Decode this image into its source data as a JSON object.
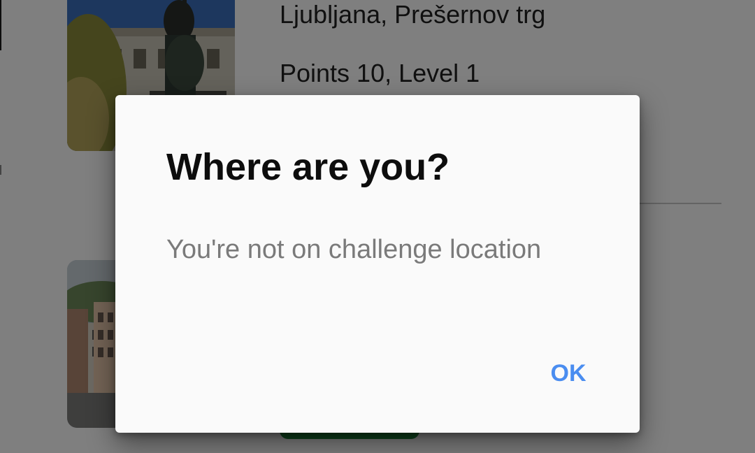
{
  "list": {
    "items": [
      {
        "title": "Ljubljana, Prešernov trg",
        "meta": "Points 10, Level 1",
        "image_icon": "monument-photo"
      },
      {
        "image_icon": "street-photo"
      }
    ]
  },
  "dialog": {
    "title": "Where are you?",
    "message": "You're not on challenge location",
    "ok_label": "OK"
  },
  "colors": {
    "accent": "#4a8df0",
    "success": "#1c8a3c",
    "scrim": "rgba(0,0,0,0.5)"
  }
}
